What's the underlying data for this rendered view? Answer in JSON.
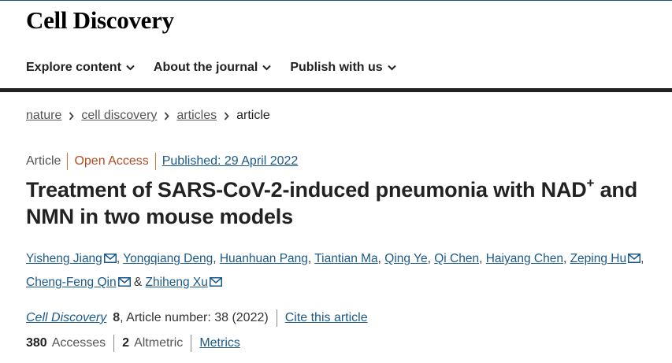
{
  "header": {
    "logo": "Cell Discovery",
    "nav": [
      {
        "label": "Explore content"
      },
      {
        "label": "About the journal"
      },
      {
        "label": "Publish with us"
      }
    ]
  },
  "breadcrumb": [
    {
      "label": "nature",
      "link": true
    },
    {
      "label": "cell discovery",
      "link": true
    },
    {
      "label": "articles",
      "link": true
    },
    {
      "label": "article",
      "link": false
    }
  ],
  "article": {
    "type": "Article",
    "access": "Open Access",
    "published": "Published: 29 April 2022",
    "title_part1": "Treatment of SARS-CoV-2-induced pneumonia with NAD",
    "title_sup": "+",
    "title_part2": " and NMN in two mouse models",
    "authors": [
      {
        "name": "Yisheng Jiang",
        "sep": ", "
      },
      {
        "name": "Yongqiang Deng",
        "sep": ", "
      },
      {
        "name": "Huanhuan Pang",
        "sep": ", "
      },
      {
        "name": "Tiantian Ma",
        "sep": ", "
      },
      {
        "name": "Qing Ye",
        "sep": ", "
      },
      {
        "name": "Qi Chen",
        "sep": ", "
      },
      {
        "name": "Haiyang Chen",
        "sep": ", "
      },
      {
        "name": "Zeping Hu",
        "sep": ", "
      },
      {
        "name": "Cheng-Feng Qin",
        "sep": " & "
      },
      {
        "name": "Zhiheng Xu",
        "sep": ""
      }
    ],
    "journal": "Cell Discovery",
    "volume": "8",
    "article_number": ", Article number: 38 (2022)",
    "cite_label": "Cite this article",
    "accesses_count": "380",
    "accesses_label": "Accesses",
    "altmetric_count": "2",
    "altmetric_label": "Altmetric",
    "metrics_label": "Metrics"
  },
  "colors": {
    "link": "#1a5a8a",
    "open_access": "#b04b22",
    "nav_bar": "#222222"
  },
  "icons": {
    "nav": "chevron-down-icon",
    "breadcrumb": "chevron-right-icon",
    "author": "mail-icon"
  }
}
